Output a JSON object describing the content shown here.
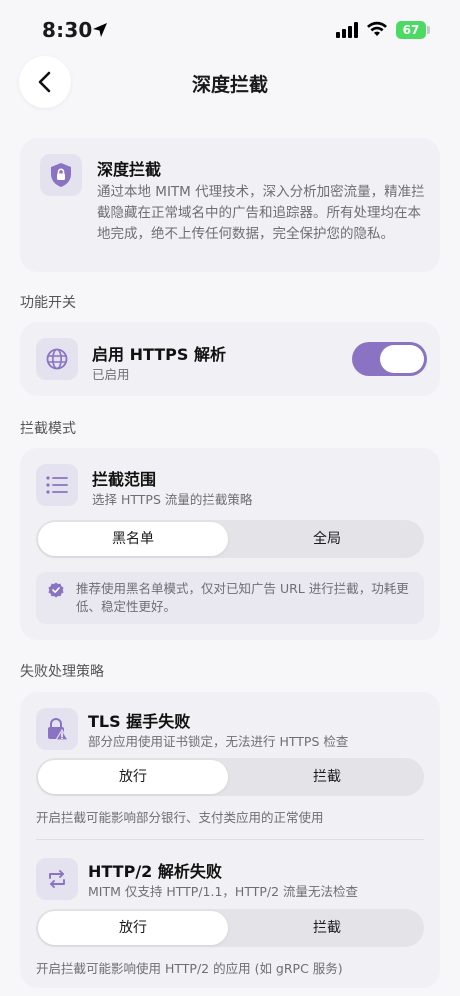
{
  "status": {
    "time": "8:30",
    "battery": "67"
  },
  "header": {
    "title": "深度拦截"
  },
  "info": {
    "title": "深度拦截",
    "description": "通过本地 MITM 代理技术，深入分析加密流量，精准拦截隐藏在正常域名中的广告和追踪器。所有处理均在本地完成，绝不上传任何数据，完全保护您的隐私。"
  },
  "sections": {
    "feature_switch": "功能开关",
    "block_mode": "拦截模式",
    "failure_policy": "失败处理策略"
  },
  "https_toggle": {
    "title": "启用 HTTPS 解析",
    "status": "已启用",
    "enabled": true
  },
  "block_scope": {
    "title": "拦截范围",
    "subtitle": "选择 HTTPS 流量的拦截策略",
    "options": [
      "黑名单",
      "全局"
    ],
    "selected": "黑名单",
    "tip": "推荐使用黑名单模式，仅对已知广告 URL 进行拦截，功耗更低、稳定性更好。"
  },
  "tls_failure": {
    "title": "TLS 握手失败",
    "subtitle": "部分应用使用证书锁定，无法进行 HTTPS 检查",
    "options": [
      "放行",
      "拦截"
    ],
    "selected": "放行",
    "note": "开启拦截可能影响部分银行、支付类应用的正常使用"
  },
  "http2_failure": {
    "title": "HTTP/2 解析失败",
    "subtitle": "MITM 仅支持 HTTP/1.1，HTTP/2 流量无法检查",
    "options": [
      "放行",
      "拦截"
    ],
    "selected": "放行",
    "note": "开启拦截可能影响使用 HTTP/2 的应用 (如 gRPC 服务)"
  },
  "colors": {
    "accent": "#8a73c2",
    "icon_bg": "#e4e2ee",
    "battery": "#4cd964"
  },
  "icons": [
    "location-arrow-icon",
    "cellular-signal-icon",
    "wifi-icon",
    "battery-icon",
    "chevron-left-icon",
    "shield-lock-icon",
    "globe-icon",
    "list-icon",
    "verified-badge-icon",
    "lock-warning-icon",
    "sync-arrows-icon"
  ]
}
